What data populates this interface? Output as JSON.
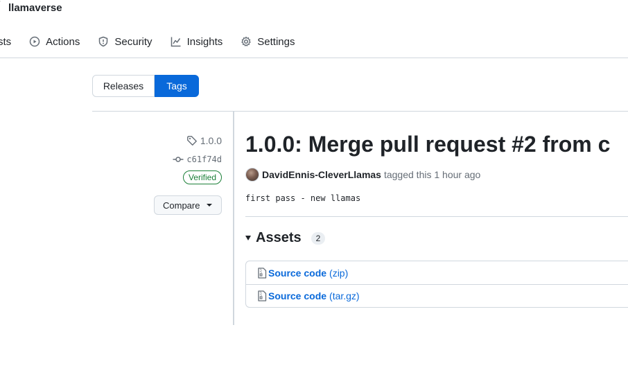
{
  "repo": {
    "name": "llamaverse"
  },
  "nav": [
    {
      "label": "sts",
      "icon": "list-icon"
    },
    {
      "label": "Actions",
      "icon": "play-icon"
    },
    {
      "label": "Security",
      "icon": "shield-icon"
    },
    {
      "label": "Insights",
      "icon": "graph-icon"
    },
    {
      "label": "Settings",
      "icon": "gear-icon"
    }
  ],
  "toggle": {
    "releases": "Releases",
    "tags": "Tags",
    "active": "Tags"
  },
  "release": {
    "tag": "1.0.0",
    "commit": "c61f74d",
    "verified": "Verified",
    "compare": "Compare",
    "title": "1.0.0: Merge pull request #2 from c",
    "author": "DavidEnnis-CleverLlamas",
    "tagged_text": "tagged this 1 hour ago",
    "notes": "first pass - new llamas"
  },
  "assets": {
    "title": "Assets",
    "count": "2",
    "items": [
      {
        "name": "Source code",
        "ext": "(zip)"
      },
      {
        "name": "Source code",
        "ext": "(tar.gz)"
      }
    ]
  },
  "colors": {
    "accent": "#0969da",
    "verified": "#1a7f37",
    "border": "#d0d7de"
  }
}
